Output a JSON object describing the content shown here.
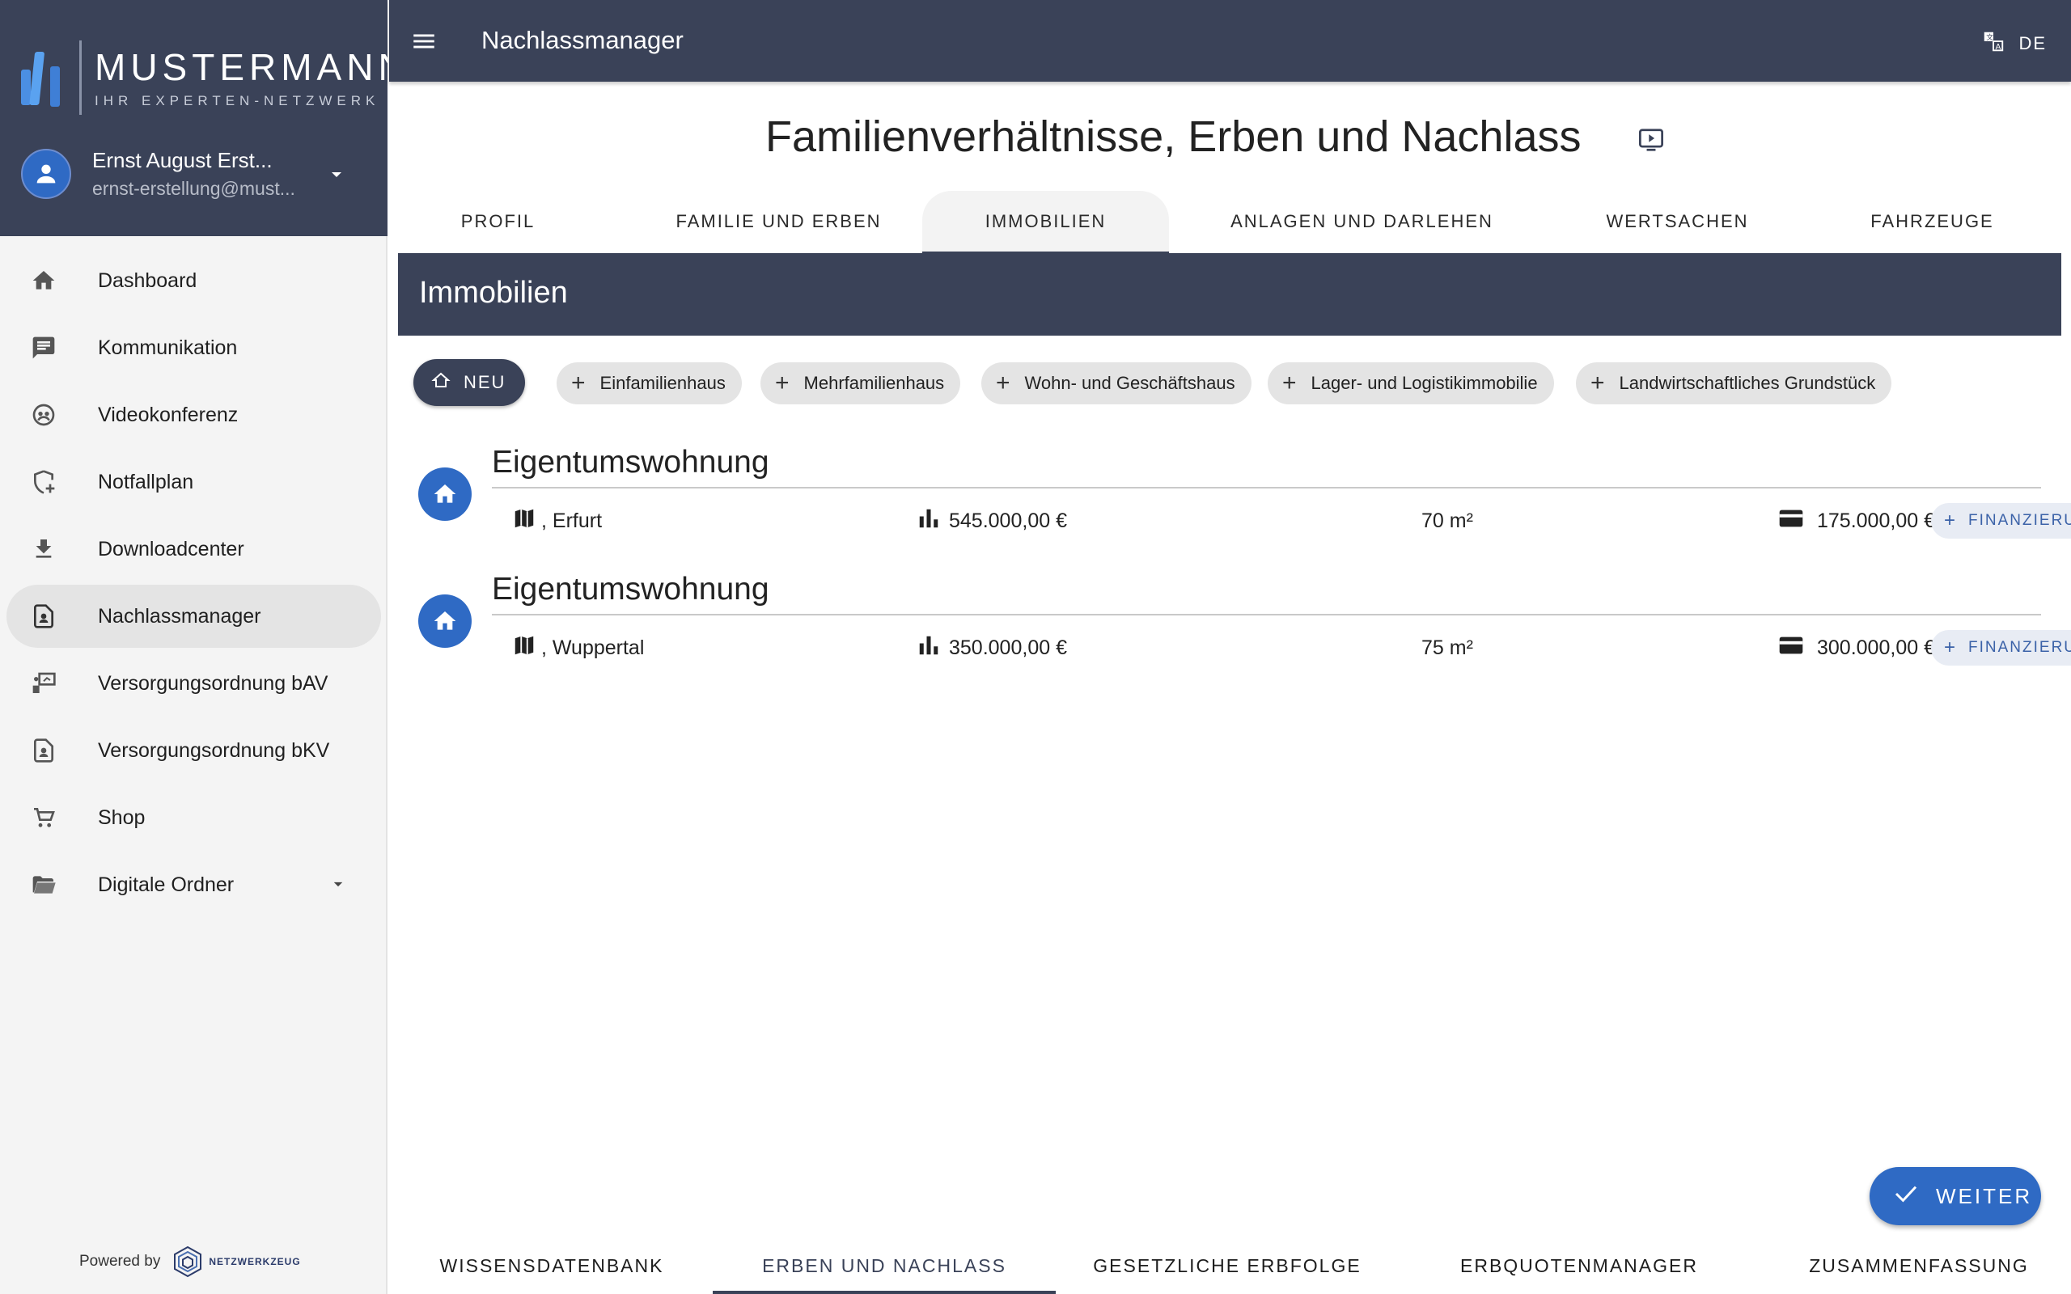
{
  "brand": {
    "name": "MUSTERMANN",
    "tagline": "IHR EXPERTEN-NETZWERK"
  },
  "user": {
    "name": "Ernst August Erst...",
    "email": "ernst-erstellung@must..."
  },
  "sidebar": {
    "items": [
      {
        "label": "Dashboard",
        "icon": "home-icon"
      },
      {
        "label": "Kommunikation",
        "icon": "chat-icon"
      },
      {
        "label": "Videokonferenz",
        "icon": "video-conference-icon"
      },
      {
        "label": "Notfallplan",
        "icon": "shield-plus-icon"
      },
      {
        "label": "Downloadcenter",
        "icon": "download-icon"
      },
      {
        "label": "Nachlassmanager",
        "icon": "document-person-icon",
        "active": true
      },
      {
        "label": "Versorgungsordnung bAV",
        "icon": "presentation-icon"
      },
      {
        "label": "Versorgungsordnung bKV",
        "icon": "document-person-icon"
      },
      {
        "label": "Shop",
        "icon": "cart-icon"
      },
      {
        "label": "Digitale Ordner",
        "icon": "folder-open-icon",
        "expandable": true
      }
    ],
    "powered_by": "Powered by",
    "powered_logo": "NETZWERKZEUG"
  },
  "topbar": {
    "title": "Nachlassmanager",
    "language": "DE"
  },
  "page": {
    "title": "Familienverhältnisse, Erben und Nachlass"
  },
  "tabs": [
    "PROFIL",
    "FAMILIE UND ERBEN",
    "IMMOBILIEN",
    "ANLAGEN UND DARLEHEN",
    "WERTSACHEN",
    "FAHRZEUGE"
  ],
  "active_tab": "IMMOBILIEN",
  "section": {
    "title": "Immobilien"
  },
  "chips": {
    "new_label": "NEU",
    "items": [
      "Einfamilienhaus",
      "Mehrfamilienhaus",
      "Wohn- und Geschäftshaus",
      "Lager- und Logistikimmobilie",
      "Landwirtschaftliches Grundstück"
    ]
  },
  "properties": [
    {
      "title": "Eigentumswohnung",
      "location": ", Erfurt",
      "value": "545.000,00 €",
      "area": "70 m²",
      "financing": "175.000,00 €",
      "financing_button": "FINANZIERUNG"
    },
    {
      "title": "Eigentumswohnung",
      "location": ", Wuppertal",
      "value": "350.000,00 €",
      "area": "75 m²",
      "financing": "300.000,00 €",
      "financing_button": "FINANZIERUNG"
    }
  ],
  "actions": {
    "next": "WEITER"
  },
  "bottom_tabs": [
    "WISSENSDATENBANK",
    "ERBEN UND NACHLASS",
    "GESETZLICHE ERBFOLGE",
    "ERBQUOTENMANAGER",
    "ZUSAMMENFASSUNG"
  ],
  "active_bottom_tab": "ERBEN UND NACHLASS",
  "colors": {
    "primary_dark": "#3a4258",
    "accent_blue": "#2f6ac4",
    "chip_gray": "#e4e4e4"
  }
}
